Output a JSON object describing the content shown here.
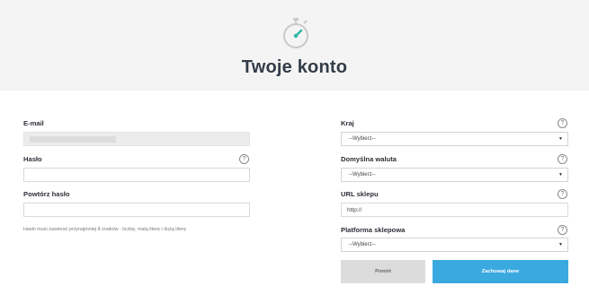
{
  "header": {
    "title": "Twoje konto",
    "icon": "stopwatch-icon",
    "icon_color": "#2bb8a3"
  },
  "left": {
    "email": {
      "label": "E-mail",
      "value": ""
    },
    "password": {
      "label": "Hasło",
      "value": ""
    },
    "repeat_password": {
      "label": "Powtórz hasło",
      "value": ""
    },
    "hint": "Hasło musi zawierać przynajmniej 8 znaków - liczbę, małą literę i dużą literę"
  },
  "right": {
    "country": {
      "label": "Kraj",
      "value": "--Wybierz--"
    },
    "currency": {
      "label": "Domyślna waluta",
      "value": "--Wybierz--"
    },
    "shop_url": {
      "label": "URL sklepu",
      "value": "http://"
    },
    "platform": {
      "label": "Platforma sklepowa",
      "value": "--Wybierz--"
    }
  },
  "help_glyph": "?",
  "caret_glyph": "▼",
  "buttons": {
    "skip": "Pomiń",
    "save": "Zachowaj dane"
  },
  "colors": {
    "primary": "#3aa9e0",
    "secondary": "#dcdcdc",
    "title": "#333c48"
  }
}
